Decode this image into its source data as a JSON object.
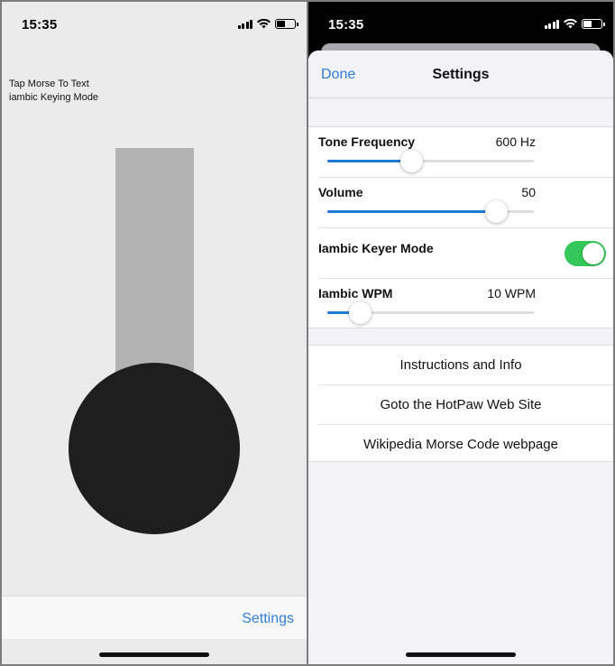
{
  "left_screen": {
    "status_bar": {
      "time": "15:35"
    },
    "info_lines": [
      "Tap Morse To Text",
      "iambic Keying Mode"
    ],
    "bottom_bar": {
      "settings_label": "Settings"
    }
  },
  "right_screen": {
    "status_bar": {
      "time": "15:35"
    },
    "nav": {
      "done_label": "Done",
      "title": "Settings"
    },
    "tone_frequency": {
      "label": "Tone Frequency",
      "value": "600 Hz",
      "fraction": 0.41
    },
    "volume": {
      "label": "Volume",
      "value": "50",
      "fraction": 0.82
    },
    "iambic_keyer_mode": {
      "label": "Iambic Keyer Mode",
      "on": true
    },
    "iambic_wpm": {
      "label": "Iambic WPM",
      "value": "10 WPM",
      "fraction": 0.16
    },
    "links": [
      "Instructions and Info",
      "Goto the HotPaw Web Site",
      "Wikipedia Morse Code webpage"
    ]
  },
  "colors": {
    "accent": "#2f7ed8",
    "slider_fill": "#1f7ad6",
    "toggle_on": "#34c759",
    "key_circle": "#1e1e1e",
    "paddle": "#b3b3b3"
  }
}
